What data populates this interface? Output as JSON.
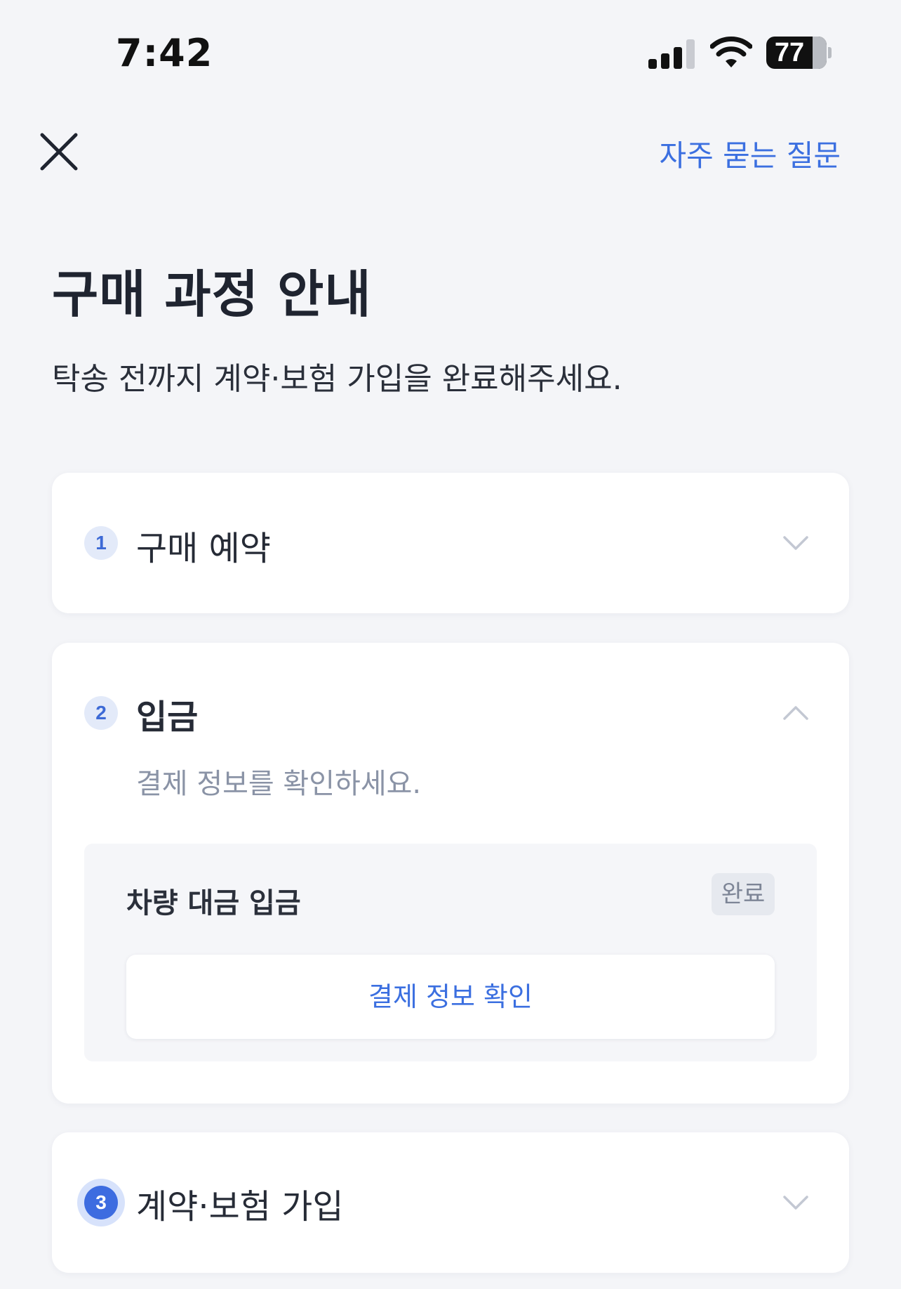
{
  "status_bar": {
    "time": "7:42",
    "battery": "77",
    "icons": [
      "signal-icon",
      "wifi-icon",
      "battery-icon"
    ]
  },
  "nav": {
    "close_icon": "close-icon",
    "faq_label": "자주 묻는 질문"
  },
  "header": {
    "title": "구매 과정 안내",
    "subtitle": "탁송 전까지 계약·보험 가입을 완료해주세요."
  },
  "steps": [
    {
      "number": "1",
      "title": "구매 예약",
      "expanded": false,
      "chevron": "chevron-down-icon"
    },
    {
      "number": "2",
      "title": "입금",
      "expanded": true,
      "chevron": "chevron-up-icon",
      "description": "결제 정보를 확인하세요.",
      "task": {
        "title": "차량 대금 입금",
        "status": "완료",
        "button_label": "결제 정보 확인"
      }
    },
    {
      "number": "3",
      "title": "계약·보험 가입",
      "expanded": false,
      "active": true,
      "chevron": "chevron-down-icon"
    }
  ],
  "colors": {
    "accent": "#3b6fe0",
    "background": "#f4f5f8",
    "card": "#ffffff",
    "muted_text": "#8a93a6"
  }
}
